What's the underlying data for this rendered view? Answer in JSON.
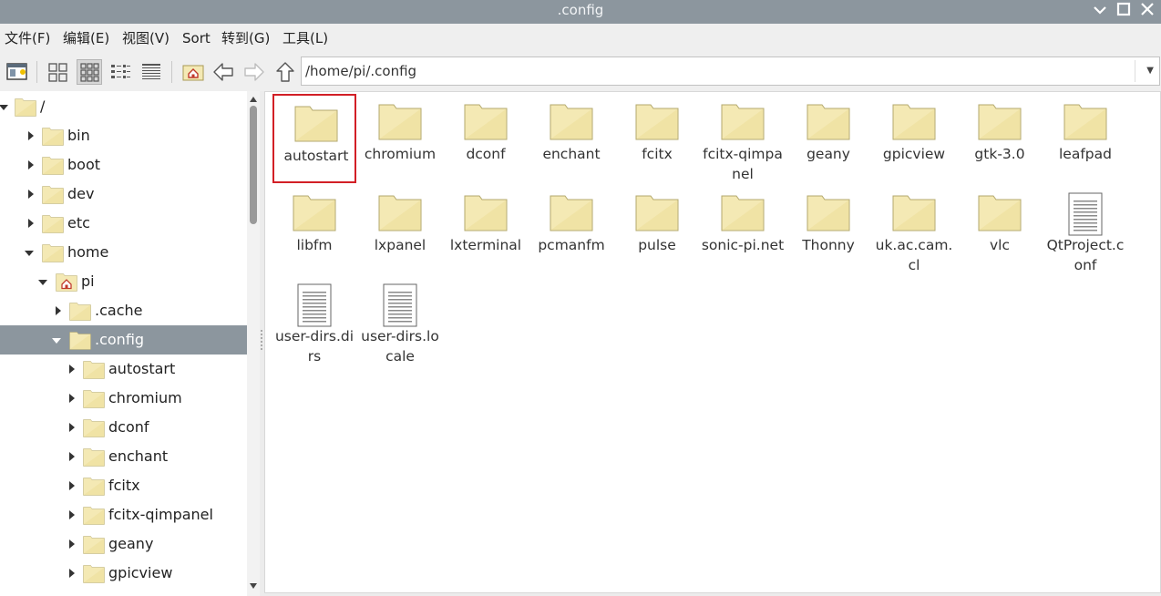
{
  "window": {
    "title": ".config"
  },
  "menu": [
    "文件(F)",
    "编辑(E)",
    "视图(V)",
    "Sort",
    "转到(G)",
    "工具(L)"
  ],
  "path": "/home/pi/.config",
  "tree": [
    {
      "label": "/",
      "depth": 0,
      "state": "expanded",
      "icon": "folder-icon"
    },
    {
      "label": "bin",
      "depth": 1,
      "state": "collapsed",
      "icon": "folder-icon"
    },
    {
      "label": "boot",
      "depth": 1,
      "state": "collapsed",
      "icon": "folder-icon"
    },
    {
      "label": "dev",
      "depth": 1,
      "state": "collapsed",
      "icon": "folder-icon"
    },
    {
      "label": "etc",
      "depth": 1,
      "state": "collapsed",
      "icon": "folder-icon"
    },
    {
      "label": "home",
      "depth": 1,
      "state": "expanded",
      "icon": "folder-icon"
    },
    {
      "label": "pi",
      "depth": 2,
      "state": "expanded",
      "icon": "home-folder-icon"
    },
    {
      "label": ".cache",
      "depth": 3,
      "state": "collapsed",
      "icon": "folder-icon"
    },
    {
      "label": ".config",
      "depth": 3,
      "state": "expanded",
      "icon": "folder-icon",
      "selected": true
    },
    {
      "label": "autostart",
      "depth": 4,
      "state": "collapsed",
      "icon": "folder-icon"
    },
    {
      "label": "chromium",
      "depth": 4,
      "state": "collapsed",
      "icon": "folder-icon"
    },
    {
      "label": "dconf",
      "depth": 4,
      "state": "collapsed",
      "icon": "folder-icon"
    },
    {
      "label": "enchant",
      "depth": 4,
      "state": "collapsed",
      "icon": "folder-icon"
    },
    {
      "label": "fcitx",
      "depth": 4,
      "state": "collapsed",
      "icon": "folder-icon"
    },
    {
      "label": "fcitx-qimpanel",
      "depth": 4,
      "state": "collapsed",
      "icon": "folder-icon"
    },
    {
      "label": "geany",
      "depth": 4,
      "state": "collapsed",
      "icon": "folder-icon"
    },
    {
      "label": "gpicview",
      "depth": 4,
      "state": "collapsed",
      "icon": "folder-icon"
    }
  ],
  "items": [
    {
      "name": "autostart",
      "type": "folder",
      "selected": true
    },
    {
      "name": "chromium",
      "type": "folder"
    },
    {
      "name": "dconf",
      "type": "folder"
    },
    {
      "name": "enchant",
      "type": "folder"
    },
    {
      "name": "fcitx",
      "type": "folder"
    },
    {
      "name": "fcitx-qimpanel",
      "type": "folder"
    },
    {
      "name": "geany",
      "type": "folder"
    },
    {
      "name": "gpicview",
      "type": "folder"
    },
    {
      "name": "gtk-3.0",
      "type": "folder"
    },
    {
      "name": "leafpad",
      "type": "folder"
    },
    {
      "name": "libfm",
      "type": "folder"
    },
    {
      "name": "lxpanel",
      "type": "folder"
    },
    {
      "name": "lxterminal",
      "type": "folder"
    },
    {
      "name": "pcmanfm",
      "type": "folder"
    },
    {
      "name": "pulse",
      "type": "folder"
    },
    {
      "name": "sonic-pi.net",
      "type": "folder"
    },
    {
      "name": "Thonny",
      "type": "folder"
    },
    {
      "name": "uk.ac.cam.cl",
      "type": "folder"
    },
    {
      "name": "vlc",
      "type": "folder"
    },
    {
      "name": "QtProject.conf",
      "type": "file"
    },
    {
      "name": "user-dirs.dirs",
      "type": "file"
    },
    {
      "name": "user-dirs.locale",
      "type": "file"
    }
  ],
  "colors": {
    "titlebar": "#8c969e",
    "selection": "#8c969e",
    "highlight_border": "#d21f26",
    "folder": "#f4e9b4"
  }
}
